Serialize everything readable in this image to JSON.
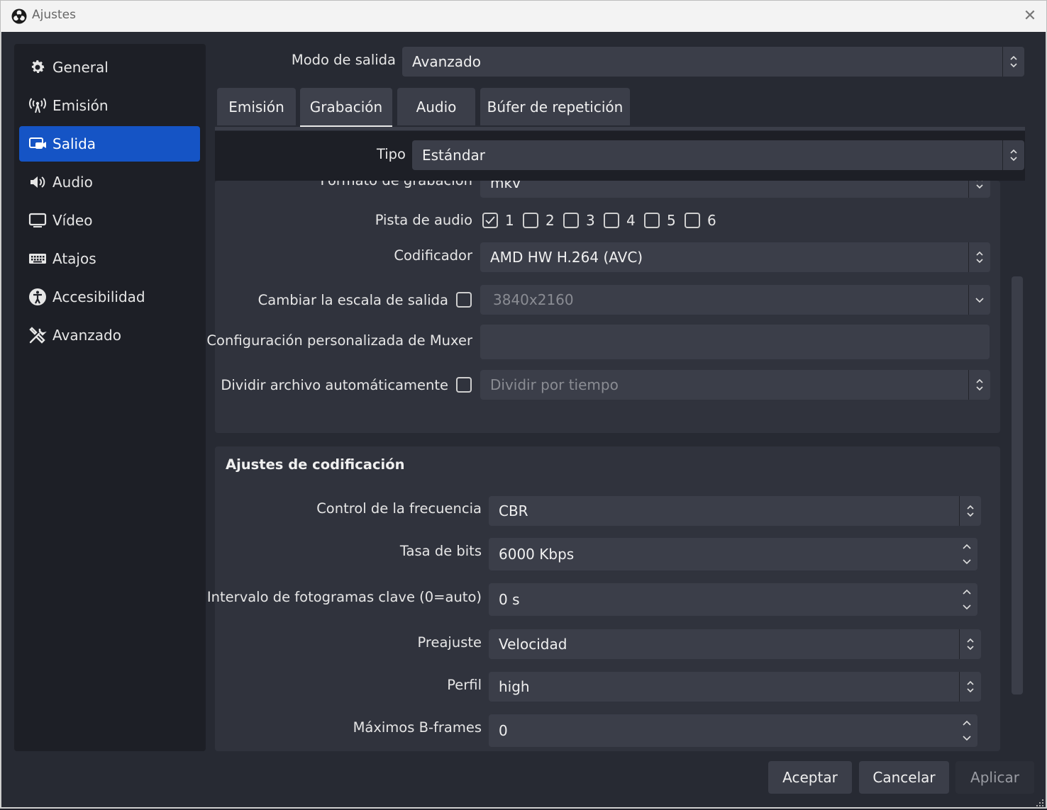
{
  "window": {
    "title": "Ajustes",
    "close_glyph": "✕"
  },
  "sidebar": {
    "items": [
      {
        "label": "General",
        "icon": "gear-icon"
      },
      {
        "label": "Emisión",
        "icon": "broadcast-icon"
      },
      {
        "label": "Salida",
        "icon": "output-icon",
        "active": true
      },
      {
        "label": "Audio",
        "icon": "speaker-icon"
      },
      {
        "label": "Vídeo",
        "icon": "monitor-icon"
      },
      {
        "label": "Atajos",
        "icon": "keyboard-icon"
      },
      {
        "label": "Accesibilidad",
        "icon": "accessibility-icon"
      },
      {
        "label": "Avanzado",
        "icon": "tools-icon"
      }
    ]
  },
  "output_mode": {
    "label": "Modo de salida",
    "value": "Avanzado"
  },
  "tabs": [
    {
      "label": "Emisión"
    },
    {
      "label": "Grabación",
      "active": true
    },
    {
      "label": "Audio"
    },
    {
      "label": "Búfer de repetición"
    }
  ],
  "type": {
    "label": "Tipo",
    "value": "Estándar"
  },
  "recording": {
    "format_label": "Formato de grabación",
    "format_value": "mkv",
    "audio_track_label": "Pista de audio",
    "audio_tracks": [
      {
        "num": "1",
        "checked": true
      },
      {
        "num": "2",
        "checked": false
      },
      {
        "num": "3",
        "checked": false
      },
      {
        "num": "4",
        "checked": false
      },
      {
        "num": "5",
        "checked": false
      },
      {
        "num": "6",
        "checked": false
      }
    ],
    "encoder_label": "Codificador",
    "encoder_value": "AMD HW H.264 (AVC)",
    "rescale_label": "Cambiar la escala de salida",
    "rescale_value": "3840x2160",
    "muxer_label": "Configuración personalizada de Muxer",
    "muxer_value": "",
    "split_label": "Dividir archivo automáticamente",
    "split_value": "Dividir por tiempo"
  },
  "encoding": {
    "title": "Ajustes de codificación",
    "rate_control_label": "Control de la frecuencia",
    "rate_control_value": "CBR",
    "bitrate_label": "Tasa de bits",
    "bitrate_value": "6000 Kbps",
    "keyframe_label": "Intervalo de fotogramas clave (0=auto)",
    "keyframe_value": "0 s",
    "preset_label": "Preajuste",
    "preset_value": "Velocidad",
    "profile_label": "Perfil",
    "profile_value": "high",
    "bframes_label": "Máximos B-frames",
    "bframes_value": "0"
  },
  "buttons": {
    "ok": "Aceptar",
    "cancel": "Cancelar",
    "apply": "Aplicar"
  }
}
